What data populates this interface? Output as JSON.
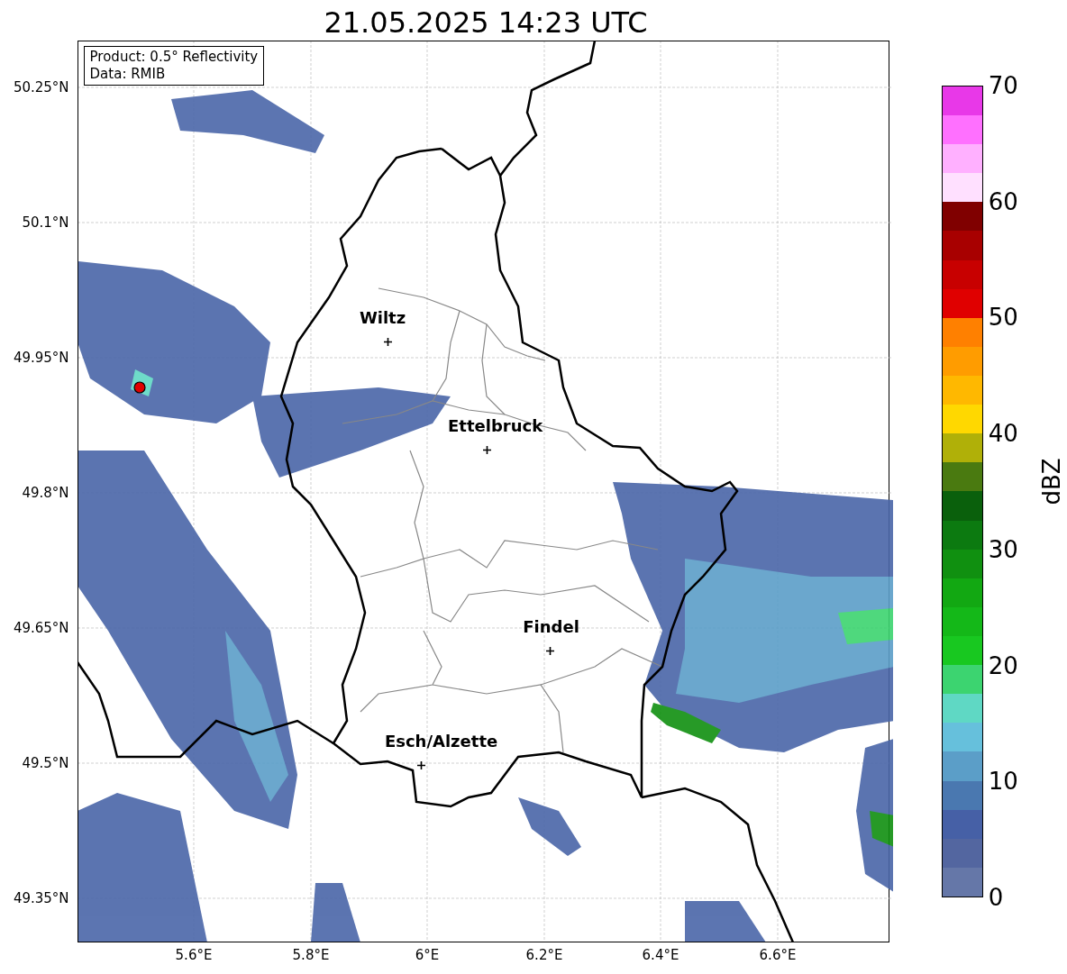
{
  "title": "21.05.2025 14:23 UTC",
  "info_box": [
    "Product: 0.5° Reflectivity",
    "Data: RMIB"
  ],
  "map": {
    "cities": [
      {
        "name": "Wiltz"
      },
      {
        "name": "Ettelbruck"
      },
      {
        "name": "Findel"
      },
      {
        "name": "Esch/Alzette"
      }
    ],
    "y_ticks": [
      "50.25°N",
      "50.1°N",
      "49.95°N",
      "49.8°N",
      "49.65°N",
      "49.5°N",
      "49.35°N"
    ],
    "x_ticks": [
      "5.6°E",
      "5.8°E",
      "6°E",
      "6.2°E",
      "6.4°E",
      "6.6°E"
    ]
  },
  "colorbar": {
    "label": "dBZ",
    "ticks": [
      "70",
      "60",
      "50",
      "40",
      "30",
      "20",
      "10",
      "0"
    ],
    "bins": [
      {
        "color": "#6577a8"
      },
      {
        "color": "#5366a0"
      },
      {
        "color": "#4660a6"
      },
      {
        "color": "#4a78b0"
      },
      {
        "color": "#5b9ec8"
      },
      {
        "color": "#66c0dc"
      },
      {
        "color": "#5fd8c4"
      },
      {
        "color": "#3cd470"
      },
      {
        "color": "#18c820"
      },
      {
        "color": "#14b818"
      },
      {
        "color": "#12a812"
      },
      {
        "color": "#109010"
      },
      {
        "color": "#0c7a10"
      },
      {
        "color": "#0a600c"
      },
      {
        "color": "#4a7a10"
      },
      {
        "color": "#b0b008"
      },
      {
        "color": "#ffd800"
      },
      {
        "color": "#ffb800"
      },
      {
        "color": "#ff9c00"
      },
      {
        "color": "#ff8000"
      },
      {
        "color": "#e00000"
      },
      {
        "color": "#c80000"
      },
      {
        "color": "#a80000"
      },
      {
        "color": "#800000"
      },
      {
        "color": "#ffe0ff"
      },
      {
        "color": "#ffb0ff"
      },
      {
        "color": "#ff70ff"
      },
      {
        "color": "#e838e8"
      }
    ]
  }
}
